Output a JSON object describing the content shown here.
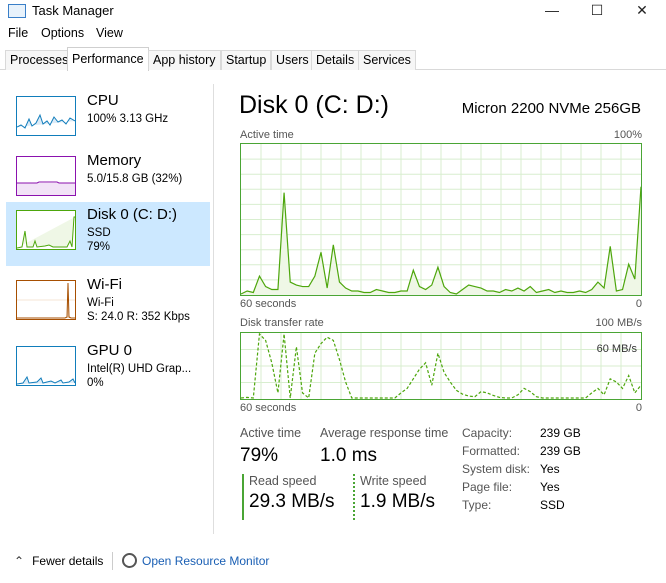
{
  "window": {
    "title": "Task Manager",
    "controls": {
      "minimize": "—",
      "maximize": "☐",
      "close": "✕"
    }
  },
  "menu": [
    "File",
    "Options",
    "View"
  ],
  "tabs": [
    {
      "label": "Processes",
      "active": false
    },
    {
      "label": "Performance",
      "active": true
    },
    {
      "label": "App history",
      "active": false
    },
    {
      "label": "Startup",
      "active": false
    },
    {
      "label": "Users",
      "active": false
    },
    {
      "label": "Details",
      "active": false
    },
    {
      "label": "Services",
      "active": false
    }
  ],
  "sidebar": {
    "items": [
      {
        "title": "CPU",
        "line1": "100%  3.13 GHz",
        "line2": "",
        "color": "#117dbb",
        "selected": false
      },
      {
        "title": "Memory",
        "line1": "5.0/15.8 GB (32%)",
        "line2": "",
        "color": "#8b12ae",
        "selected": false
      },
      {
        "title": "Disk 0 (C: D:)",
        "line1": "SSD",
        "line2": "79%",
        "color": "#4da60c",
        "selected": true
      },
      {
        "title": "Wi-Fi",
        "line1": "Wi-Fi",
        "line2": "S: 24.0  R: 352 Kbps",
        "color": "#a74f01",
        "selected": false
      },
      {
        "title": "GPU 0",
        "line1": "Intel(R) UHD Grap...",
        "line2": "0%",
        "color": "#117dbb",
        "selected": false
      }
    ]
  },
  "main": {
    "title": "Disk 0 (C: D:)",
    "model": "Micron 2200 NVMe 256GB",
    "active_graph": {
      "label": "Active time",
      "max_label": "100%",
      "left_label": "60 seconds",
      "right_label": "0",
      "values": [
        0,
        2,
        1,
        12,
        5,
        3,
        3,
        68,
        8,
        6,
        5,
        5,
        12,
        28,
        4,
        33,
        8,
        4,
        2,
        2,
        1,
        1,
        3,
        2,
        1,
        1,
        2,
        2,
        16,
        5,
        3,
        6,
        18,
        5,
        1,
        0,
        3,
        6,
        5,
        4,
        2,
        2,
        1,
        3,
        2,
        4,
        2,
        5,
        1,
        2,
        3,
        1,
        2,
        1,
        1,
        2,
        1,
        3,
        8,
        4,
        32,
        2,
        3,
        20,
        10,
        72
      ]
    },
    "transfer_graph": {
      "label": "Disk transfer rate",
      "max_label": "100 MB/s",
      "mid_label": "60 MB/s",
      "left_label": "60 seconds",
      "right_label": "0",
      "values": [
        0,
        1,
        0,
        100,
        90,
        55,
        8,
        100,
        0,
        80,
        8,
        0,
        70,
        85,
        95,
        90,
        60,
        25,
        0,
        0,
        0,
        0,
        0,
        0,
        0,
        0,
        8,
        15,
        30,
        45,
        55,
        20,
        70,
        40,
        25,
        12,
        6,
        3,
        2,
        10,
        8,
        4,
        1,
        0,
        0,
        5,
        15,
        10,
        2,
        0,
        0,
        0,
        0,
        0,
        0,
        0,
        0,
        8,
        15,
        5,
        30,
        25,
        15,
        35,
        8,
        20
      ]
    },
    "stats": {
      "active_time_label": "Active time",
      "active_time_value": "79%",
      "avg_response_label": "Average response time",
      "avg_response_value": "1.0 ms",
      "read_label": "Read speed",
      "read_value": "29.3 MB/s",
      "write_label": "Write speed",
      "write_value": "1.9 MB/s"
    },
    "properties": [
      {
        "label": "Capacity:",
        "value": "239 GB"
      },
      {
        "label": "Formatted:",
        "value": "239 GB"
      },
      {
        "label": "System disk:",
        "value": "Yes"
      },
      {
        "label": "Page file:",
        "value": "Yes"
      },
      {
        "label": "Type:",
        "value": "SSD"
      }
    ]
  },
  "footer": {
    "fewer_details": "Fewer details",
    "open_monitor": "Open Resource Monitor"
  },
  "colors": {
    "disk_line": "#4da60c",
    "disk_fill": "#eff7e6",
    "grid": "#d8eecf",
    "selected_bg": "#cce8ff",
    "link": "#1a5fb4"
  }
}
